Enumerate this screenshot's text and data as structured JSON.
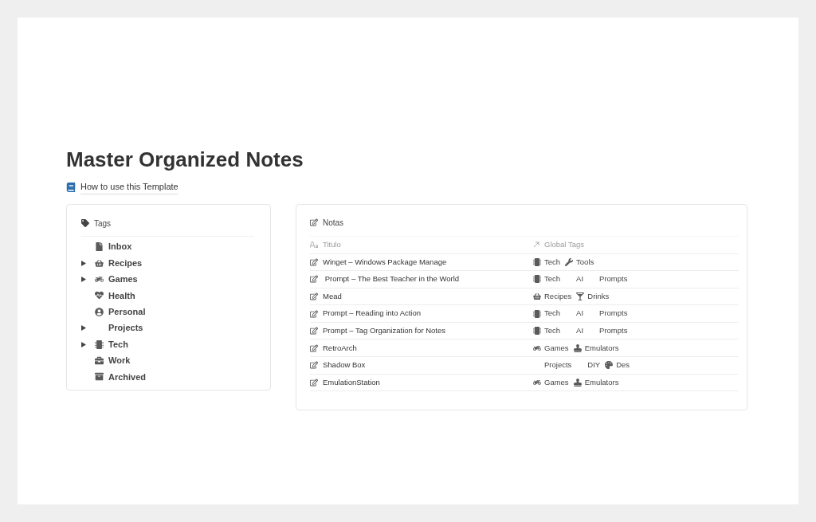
{
  "page": {
    "title": "Master Organized Notes",
    "link": "How to use this Template"
  },
  "tags_panel": {
    "title": "Tags",
    "items": [
      {
        "label": "Inbox",
        "kind": "file",
        "expandable": false
      },
      {
        "label": "Recipes",
        "kind": "basket",
        "expandable": true
      },
      {
        "label": "Games",
        "kind": "bike",
        "expandable": true
      },
      {
        "label": "Health",
        "kind": "heartbeat",
        "expandable": false
      },
      {
        "label": "Personal",
        "kind": "user",
        "expandable": false
      },
      {
        "label": "Projects",
        "kind": "blank",
        "expandable": true
      },
      {
        "label": "Tech",
        "kind": "chip",
        "expandable": true
      },
      {
        "label": "Work",
        "kind": "briefcase",
        "expandable": false
      },
      {
        "label": "Archived",
        "kind": "archive",
        "expandable": false
      }
    ]
  },
  "notes_table": {
    "title": "Notas",
    "columns": [
      "Titulo",
      "Global Tags"
    ],
    "rows": [
      {
        "title": "Winget – Windows Package Manage",
        "tags": [
          {
            "label": "Tech",
            "kind": "chip"
          },
          {
            "label": "Tools",
            "kind": "wrench"
          }
        ]
      },
      {
        "title": " Prompt – The Best Teacher in the World",
        "tags": [
          {
            "label": "Tech",
            "kind": "chip"
          },
          {
            "label": "AI",
            "kind": "blank"
          },
          {
            "label": "Prompts",
            "kind": "blank"
          }
        ]
      },
      {
        "title": "Mead",
        "tags": [
          {
            "label": "Recipes",
            "kind": "basket"
          },
          {
            "label": "Drinks",
            "kind": "glass"
          }
        ]
      },
      {
        "title": "Prompt – Reading into Action",
        "tags": [
          {
            "label": "Tech",
            "kind": "chip"
          },
          {
            "label": "AI",
            "kind": "blank"
          },
          {
            "label": "Prompts",
            "kind": "blank"
          }
        ]
      },
      {
        "title": "Prompt – Tag Organization for Notes",
        "tags": [
          {
            "label": "Tech",
            "kind": "chip"
          },
          {
            "label": "AI",
            "kind": "blank"
          },
          {
            "label": "Prompts",
            "kind": "blank"
          }
        ]
      },
      {
        "title": "RetroArch",
        "tags": [
          {
            "label": "Games",
            "kind": "bike"
          },
          {
            "label": "Emulators",
            "kind": "stamp"
          }
        ]
      },
      {
        "title": "Shadow Box",
        "tags": [
          {
            "label": "Projects",
            "kind": "blank"
          },
          {
            "label": "DIY",
            "kind": "blank"
          },
          {
            "label": "Des",
            "kind": "palette"
          }
        ]
      },
      {
        "title": "EmulationStation",
        "tags": [
          {
            "label": "Games",
            "kind": "bike"
          },
          {
            "label": "Emulators",
            "kind": "stamp"
          }
        ]
      }
    ]
  }
}
